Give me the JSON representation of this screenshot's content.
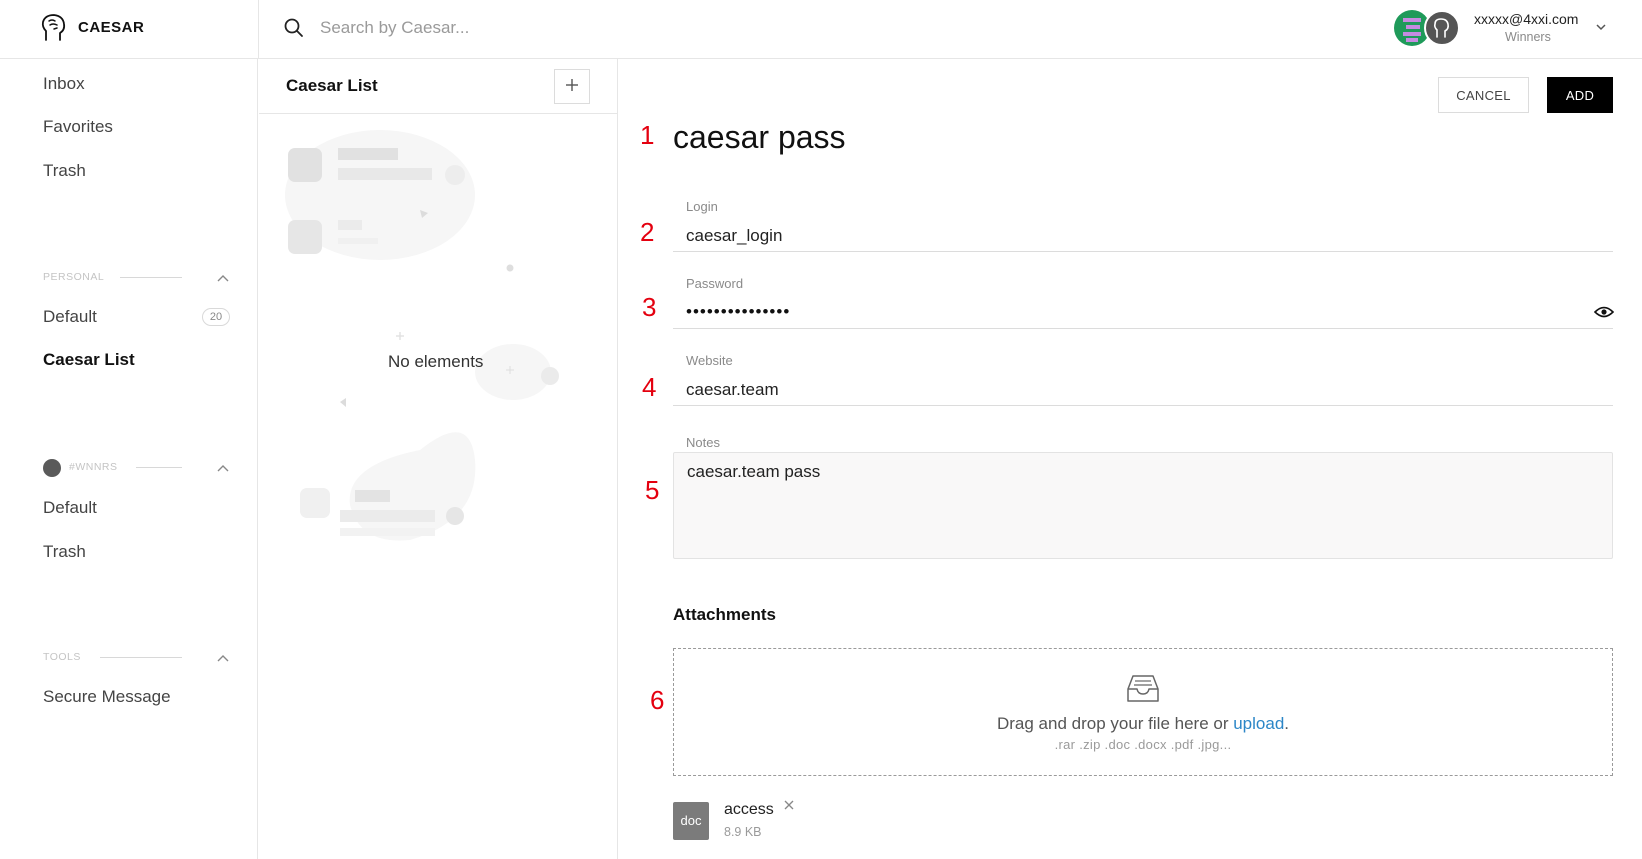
{
  "app": {
    "brand": "CAESAR"
  },
  "search": {
    "placeholder": "Search by Caesar..."
  },
  "user": {
    "email": "xxxxx@4xxi.com",
    "team": "Winners"
  },
  "sidebar": {
    "main_items": [
      {
        "label": "Inbox"
      },
      {
        "label": "Favorites"
      },
      {
        "label": "Trash"
      }
    ],
    "personal": {
      "label": "PERSONAL",
      "items": [
        {
          "label": "Default",
          "count": "20"
        },
        {
          "label": "Caesar List"
        }
      ]
    },
    "team": {
      "label": "#WNNRS",
      "items": [
        {
          "label": "Default"
        },
        {
          "label": "Trash"
        }
      ]
    },
    "tools": {
      "label": "TOOLS",
      "items": [
        {
          "label": "Secure Message"
        }
      ]
    }
  },
  "list": {
    "title": "Caesar List",
    "empty_text": "No elements"
  },
  "detail": {
    "cancel_label": "CANCEL",
    "add_label": "ADD",
    "title": "caesar pass",
    "login": {
      "label": "Login",
      "value": "caesar_login"
    },
    "password": {
      "label": "Password",
      "value": "•••••••••••••••"
    },
    "website": {
      "label": "Website",
      "value": "caesar.team"
    },
    "notes": {
      "label": "Notes",
      "value": "caesar.team pass"
    },
    "attachments": {
      "title": "Attachments",
      "drop_text": "Drag and drop your file here or ",
      "drop_link": "upload",
      "drop_end": ".",
      "formats": ".rar .zip .doc .docx .pdf .jpg...",
      "file": {
        "type": "doc",
        "name": "access",
        "size": "8.9 KB"
      }
    }
  },
  "steps": [
    "1",
    "2",
    "3",
    "4",
    "5",
    "6"
  ],
  "colors": {
    "accent": "#000000",
    "link": "#2b86c7",
    "step_marker": "#e4000f",
    "avatar_green": "#1f9a5a"
  }
}
